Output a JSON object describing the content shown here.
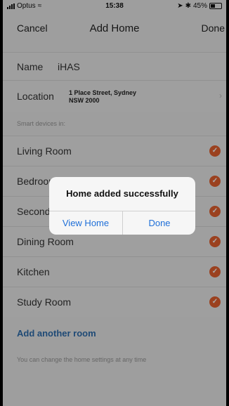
{
  "status_bar": {
    "carrier": "Optus",
    "time": "15:38",
    "battery_text": "45%",
    "battery_level": 0.45
  },
  "nav": {
    "cancel_label": "Cancel",
    "title": "Add Home",
    "done_label": "Done"
  },
  "form": {
    "name_label": "Name",
    "name_value": "iHAS",
    "location_label": "Location",
    "location_line1": "1 Place Street, Sydney",
    "location_line2": "NSW 2000"
  },
  "section_header": "Smart devices in:",
  "rooms": [
    {
      "label": "Living Room",
      "checked": true
    },
    {
      "label": "Bedroom",
      "checked": true
    },
    {
      "label": "Second",
      "checked": true
    },
    {
      "label": "Dining Room",
      "checked": true
    },
    {
      "label": "Kitchen",
      "checked": true
    },
    {
      "label": "Study Room",
      "checked": true
    }
  ],
  "add_room_label": "Add another room",
  "footer_note": "You can change the home settings at any time",
  "alert": {
    "message": "Home added successfully",
    "view_home_label": "View Home",
    "done_label": "Done"
  },
  "colors": {
    "accent_orange": "#e8622f",
    "link_blue": "#2f6fb0",
    "alert_blue": "#1f6fd8"
  }
}
